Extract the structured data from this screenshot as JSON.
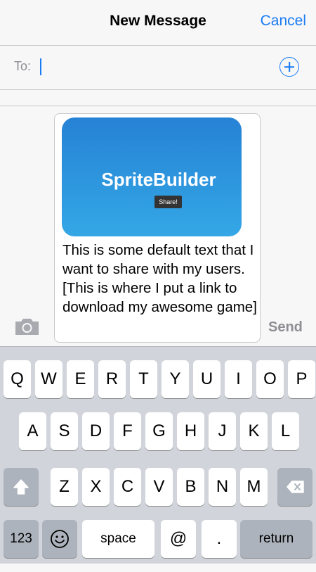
{
  "header": {
    "title": "New Message",
    "cancel_label": "Cancel"
  },
  "recipients": {
    "to_label": "To:",
    "value": ""
  },
  "attachment": {
    "app_name": "SpriteBuilder",
    "share_button": "Share!"
  },
  "message": {
    "text": "This is some default text that I want to share with my users. [This is where I put a link to download my awesome game]"
  },
  "composer": {
    "send_label": "Send"
  },
  "keyboard": {
    "row1": [
      "Q",
      "W",
      "E",
      "R",
      "T",
      "Y",
      "U",
      "I",
      "O",
      "P"
    ],
    "row2": [
      "A",
      "S",
      "D",
      "F",
      "G",
      "H",
      "J",
      "K",
      "L"
    ],
    "row3": [
      "Z",
      "X",
      "C",
      "V",
      "B",
      "N",
      "M"
    ],
    "numbers_label": "123",
    "space_label": "space",
    "at_label": "@",
    "period_label": ".",
    "return_label": "return"
  },
  "colors": {
    "accent": "#1a7cf2",
    "card_top": "#2682d5",
    "card_bottom": "#34a7e6"
  },
  "icons": {
    "add_contact": "plus-circle-icon",
    "camera": "camera-icon",
    "shift": "shift-arrow-icon",
    "delete": "backspace-icon",
    "emoji": "emoji-icon"
  }
}
